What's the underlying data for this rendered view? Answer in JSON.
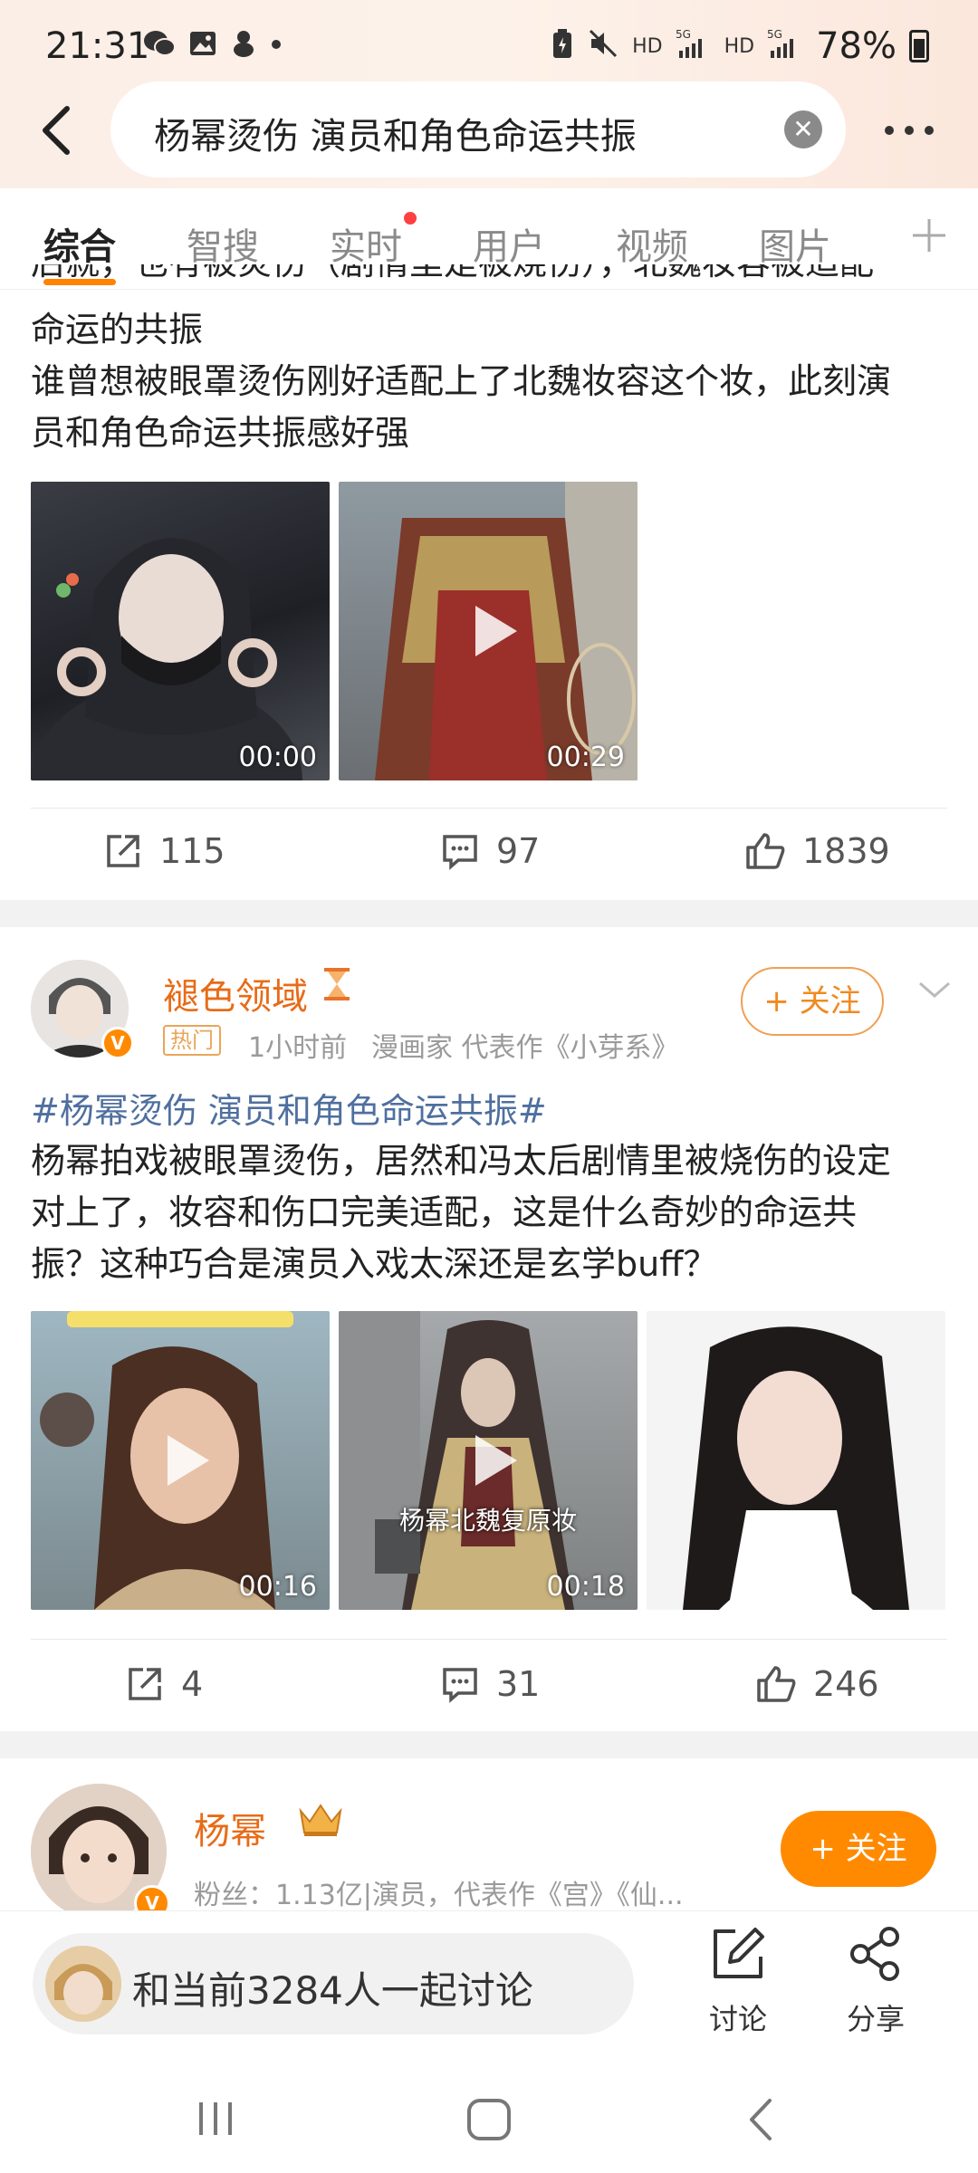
{
  "status_bar": {
    "time": "21:31",
    "battery": "78%",
    "network_labels": [
      "HD",
      "5G",
      "HD",
      "5G"
    ]
  },
  "header": {
    "search_query": "杨幂烫伤 演员和角色命运共振"
  },
  "tabs": [
    {
      "label": "综合",
      "active": true
    },
    {
      "label": "智搜",
      "active": false
    },
    {
      "label": "实时",
      "active": false,
      "dot": true
    },
    {
      "label": "用户",
      "active": false
    },
    {
      "label": "视频",
      "active": false
    },
    {
      "label": "图片",
      "active": false
    }
  ],
  "post1": {
    "text_partial_line": "后就，也有被炎伤（剧情里是被烧伤），北魏妆容被适配",
    "text_lines": [
      "命运的共振",
      "谁曾想被眼罩烫伤刚好适配上了北魏妆容这个妆，此刻演",
      "员和角色命运共振感好强"
    ],
    "media": [
      {
        "duration": "00:00"
      },
      {
        "duration": "00:29"
      }
    ],
    "reposts": "115",
    "comments": "97",
    "likes": "1839"
  },
  "post2": {
    "user": "褪色领域",
    "tag": "热门",
    "time": "1小时前",
    "bio": "漫画家 代表作《小芽系》",
    "follow_label": "+ 关注",
    "hashtag": "#杨幂烫伤 演员和角色命运共振#",
    "text_lines": [
      "杨幂拍戏被眼罩烫伤，居然和冯太后剧情里被烧伤的设定",
      "对上了，妆容和伤口完美适配，这是什么奇妙的命运共",
      "振？这种巧合是演员入戏太深还是玄学buff？"
    ],
    "media": [
      {
        "duration": "00:16",
        "caption": ""
      },
      {
        "duration": "00:18",
        "caption": "杨幂北魏复原妆"
      },
      {
        "duration": "",
        "caption": ""
      }
    ],
    "reposts": "4",
    "comments": "31",
    "likes": "246"
  },
  "user_card": {
    "name": "杨幂",
    "info": "粉丝：1.13亿|演员，代表作《宫》《仙...",
    "follow_label": "+ 关注"
  },
  "bottom_bar": {
    "discuss_text": "和当前3284人一起讨论",
    "discuss_label": "讨论",
    "share_label": "分享"
  },
  "colors": {
    "accent": "#ff8200",
    "username": "#e86b17",
    "hashtag": "#4f6f9f"
  }
}
